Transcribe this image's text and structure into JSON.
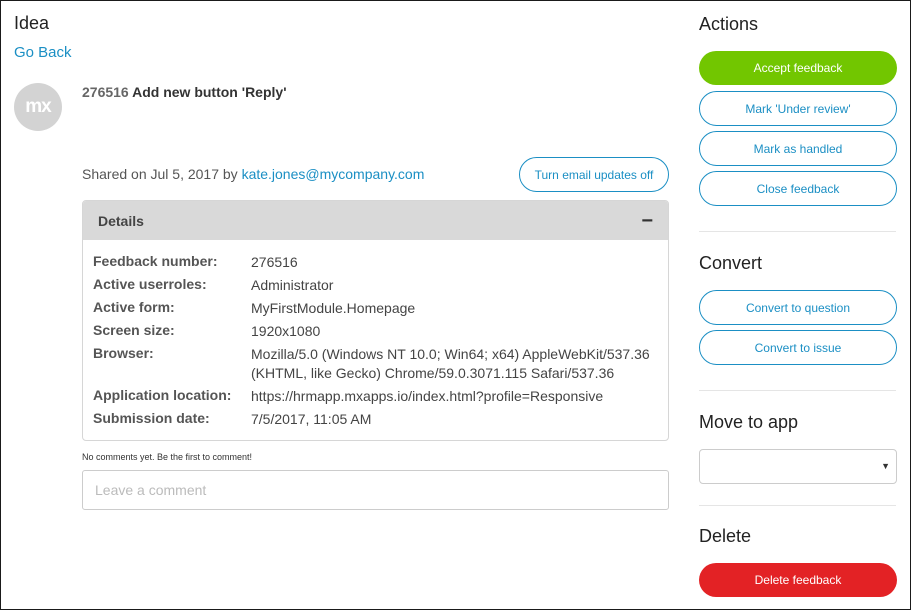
{
  "page": {
    "title": "Idea",
    "back_label": "Go Back"
  },
  "avatar": {
    "initials": "mx"
  },
  "idea": {
    "number": "276516",
    "title": "Add new button 'Reply'"
  },
  "shared": {
    "prefix": "Shared on Jul 5, 2017 by",
    "author": "kate.jones@mycompany.com"
  },
  "email_toggle_label": "Turn email updates off",
  "details": {
    "title": "Details",
    "toggle": "−",
    "rows": [
      {
        "key": "Feedback number:",
        "value": "276516"
      },
      {
        "key": "Active userroles:",
        "value": "Administrator"
      },
      {
        "key": "Active form:",
        "value": "MyFirstModule.Homepage"
      },
      {
        "key": "Screen size:",
        "value": "1920x1080"
      },
      {
        "key": "Browser:",
        "value": "Mozilla/5.0 (Windows NT 10.0; Win64; x64) AppleWebKit/537.36 (KHTML, like Gecko) Chrome/59.0.3071.115 Safari/537.36"
      },
      {
        "key": "Application location:",
        "value": "https://hrmapp.mxapps.io/index.html?profile=Responsive"
      },
      {
        "key": "Submission date:",
        "value": "7/5/2017, 11:05 AM"
      }
    ]
  },
  "comments": {
    "empty_text": "No comments yet. Be the first to comment!",
    "placeholder": "Leave a comment"
  },
  "actions": {
    "title": "Actions",
    "accept": "Accept feedback",
    "review": "Mark 'Under review'",
    "handled": "Mark as handled",
    "close": "Close feedback"
  },
  "convert": {
    "title": "Convert",
    "question": "Convert to question",
    "issue": "Convert to issue"
  },
  "move": {
    "title": "Move to app",
    "selected": "",
    "caret": "▼"
  },
  "delete": {
    "title": "Delete",
    "button": "Delete feedback"
  },
  "colors": {
    "accent": "#1b8fc4",
    "accept": "#72c600",
    "delete": "#e32225",
    "panel_header": "#d9d9d9"
  }
}
